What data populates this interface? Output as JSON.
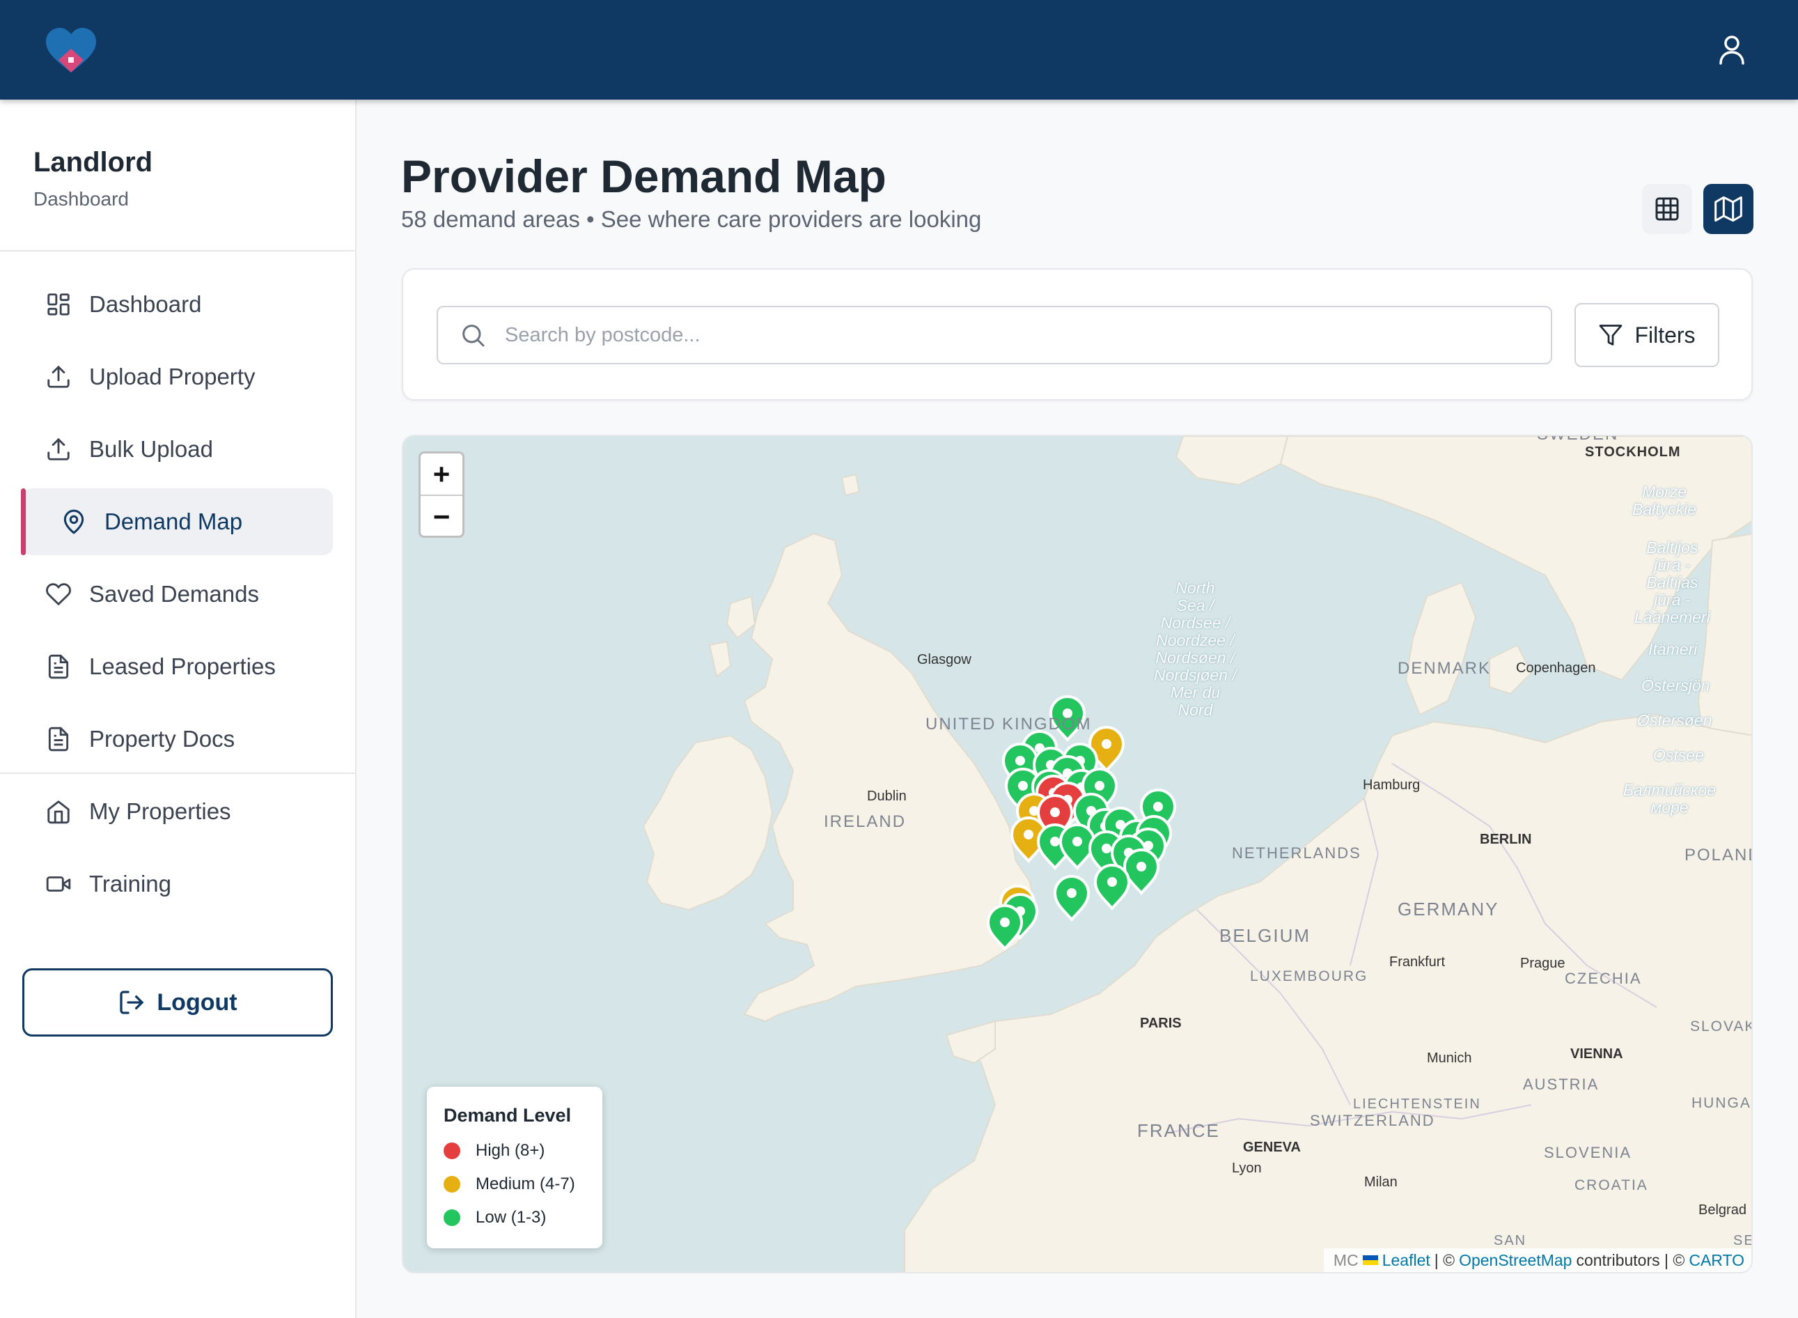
{
  "header": {
    "logo_icon": "heart-house-icon",
    "user_icon": "user-icon"
  },
  "sidebar": {
    "title": "Landlord",
    "subtitle": "Dashboard",
    "items": [
      {
        "label": "Dashboard",
        "icon": "grid-icon"
      },
      {
        "label": "Upload Property",
        "icon": "upload-icon"
      },
      {
        "label": "Bulk Upload",
        "icon": "upload-icon"
      },
      {
        "label": "Demand Map",
        "icon": "map-pin-icon",
        "active": true
      },
      {
        "label": "Saved Demands",
        "icon": "heart-icon"
      },
      {
        "label": "Leased Properties",
        "icon": "document-icon"
      },
      {
        "label": "Property Docs",
        "icon": "document-icon"
      },
      {
        "label": "My Properties",
        "icon": "home-icon"
      },
      {
        "label": "Training",
        "icon": "video-icon"
      }
    ],
    "logout_label": "Logout"
  },
  "main": {
    "title": "Provider Demand Map",
    "subtitle": "58 demand areas • See where care providers are looking",
    "search_placeholder": "Search by postcode...",
    "filters_label": "Filters"
  },
  "map": {
    "zoom_in": "+",
    "zoom_out": "−",
    "legend": {
      "title": "Demand Level",
      "items": [
        {
          "label": "High (8+)",
          "color": "#e53e3e"
        },
        {
          "label": "Medium (4-7)",
          "color": "#e6b012"
        },
        {
          "label": "Low (1-3)",
          "color": "#22c55e"
        }
      ]
    },
    "attribution": {
      "cut": "MC",
      "leaflet": "Leaflet",
      "sep1": "| ©",
      "osm": "OpenStreetMap",
      "contributors": "contributors | ©",
      "carto": "CARTO"
    },
    "labels": {
      "stockholm": "STOCKHOLM",
      "morze": "Morze\nBałtyckie",
      "baltijos": "Baltijos\njūra -\nBaltijas\njūra -\nLäänemeri",
      "itameri": "Itämeri",
      "ostersjon": "Östersjön",
      "ostersoen": "Østersøen",
      "ostsee": "Ostsee",
      "baltic_ru": "Балтийское\nморе",
      "north_sea": "North\nSea /\nNordsee /\nNoordzee /\nNordsøen /\nNordsjøen /\nMer du\nNord",
      "denmark": "DENMARK",
      "copenhagen": "Copenhagen",
      "glasgow": "Glasgow",
      "uk": "UNITED KINGDOM",
      "dublin": "Dublin",
      "ireland": "IRELAND",
      "hamburg": "Hamburg",
      "berlin": "BERLIN",
      "poland": "POLAND",
      "netherlands": "NETHERLANDS",
      "germany": "GERMANY",
      "belgium": "BELGIUM",
      "frankfurt": "Frankfurt",
      "prague": "Prague",
      "czechia": "CZECHIA",
      "luxembourg": "LUXEMBOURG",
      "paris": "PARIS",
      "slovakia": "SLOVAK",
      "munich": "Munich",
      "vienna": "VIENNA",
      "austria": "AUSTRIA",
      "hungary": "HUNGA",
      "liechtenstein": "LIECHTENSTEIN",
      "switzerland": "SWITZERLAND",
      "france": "FRANCE",
      "geneva": "GENEVA",
      "lyon": "Lyon",
      "slovenia": "SLOVENIA",
      "milan": "Milan",
      "croatia": "CROATIA",
      "belgrade": "Belgrad",
      "san": "SAN",
      "se": "SE",
      "sweden": "SWEDEN"
    },
    "markers": [
      {
        "level": "low"
      },
      {
        "level": "medium"
      },
      {
        "level": "low"
      },
      {
        "level": "low"
      },
      {
        "level": "low"
      },
      {
        "level": "low"
      },
      {
        "level": "low"
      },
      {
        "level": "low"
      },
      {
        "level": "low"
      },
      {
        "level": "low"
      },
      {
        "level": "low"
      },
      {
        "level": "high"
      },
      {
        "level": "high"
      },
      {
        "level": "medium"
      },
      {
        "level": "high"
      },
      {
        "level": "low"
      },
      {
        "level": "low"
      },
      {
        "level": "low"
      },
      {
        "level": "low"
      },
      {
        "level": "low"
      },
      {
        "level": "low"
      },
      {
        "level": "low"
      },
      {
        "level": "medium"
      },
      {
        "level": "low"
      },
      {
        "level": "low"
      },
      {
        "level": "low"
      },
      {
        "level": "low"
      },
      {
        "level": "low"
      },
      {
        "level": "medium"
      },
      {
        "level": "low"
      },
      {
        "level": "low"
      },
      {
        "level": "low"
      },
      {
        "level": "low"
      }
    ]
  }
}
